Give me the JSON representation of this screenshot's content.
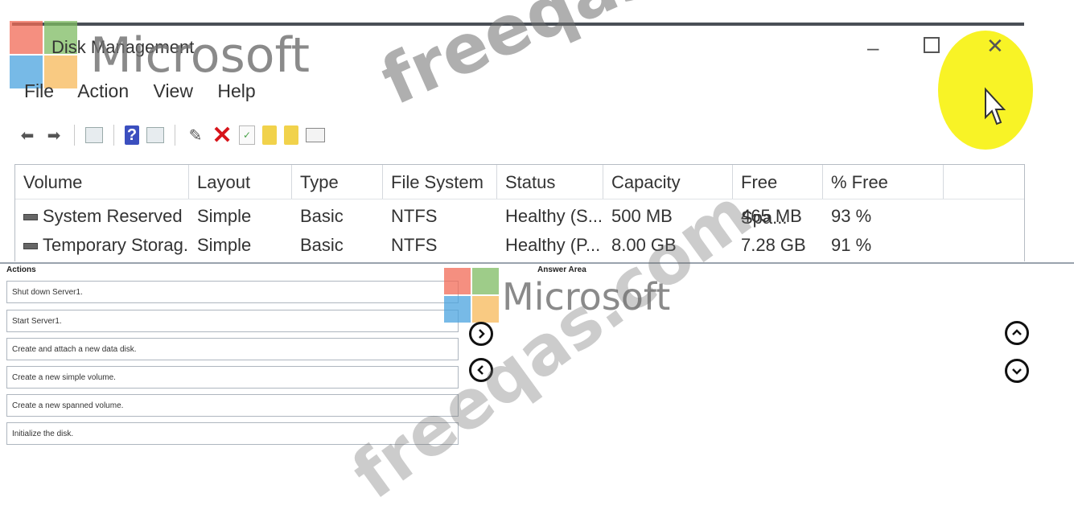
{
  "window": {
    "title": "Disk Management",
    "minimize_icon": "minimize-icon",
    "maximize_icon": "maximize-icon",
    "close_icon": "close-icon"
  },
  "menu": [
    "File",
    "Action",
    "View",
    "Help"
  ],
  "toolbar_icons": [
    "back-arrow-icon",
    "forward-arrow-icon",
    "console-icon",
    "help-icon",
    "properties-icon",
    "connect-icon",
    "delete-icon",
    "check-icon",
    "folder-up-icon",
    "folder-search-icon",
    "view-icon"
  ],
  "table": {
    "columns": [
      "Volume",
      "Layout",
      "Type",
      "File System",
      "Status",
      "Capacity",
      "Free Spa...",
      "% Free"
    ],
    "rows": [
      [
        "System Reserved",
        "Simple",
        "Basic",
        "NTFS",
        "Healthy (S...",
        "500 MB",
        "465 MB",
        "93 %"
      ],
      [
        "Temporary Storag...",
        "Simple",
        "Basic",
        "NTFS",
        "Healthy (P...",
        "8.00 GB",
        "7.28 GB",
        "91 %"
      ]
    ]
  },
  "actions_heading": "Actions",
  "answer_heading": "Answer Area",
  "actions": [
    "Shut down Server1.",
    "Start Server1.",
    "Create and attach a new data disk.",
    "Create a new simple volume.",
    "Create a new spanned volume.",
    "Initialize the disk."
  ],
  "watermark": {
    "brand": "Microsoft",
    "site": "freeqas.com"
  },
  "colors": {
    "highlight": "#f7f20e",
    "delete_icon": "#d7141a",
    "help_icon": "#3b4fbf"
  }
}
